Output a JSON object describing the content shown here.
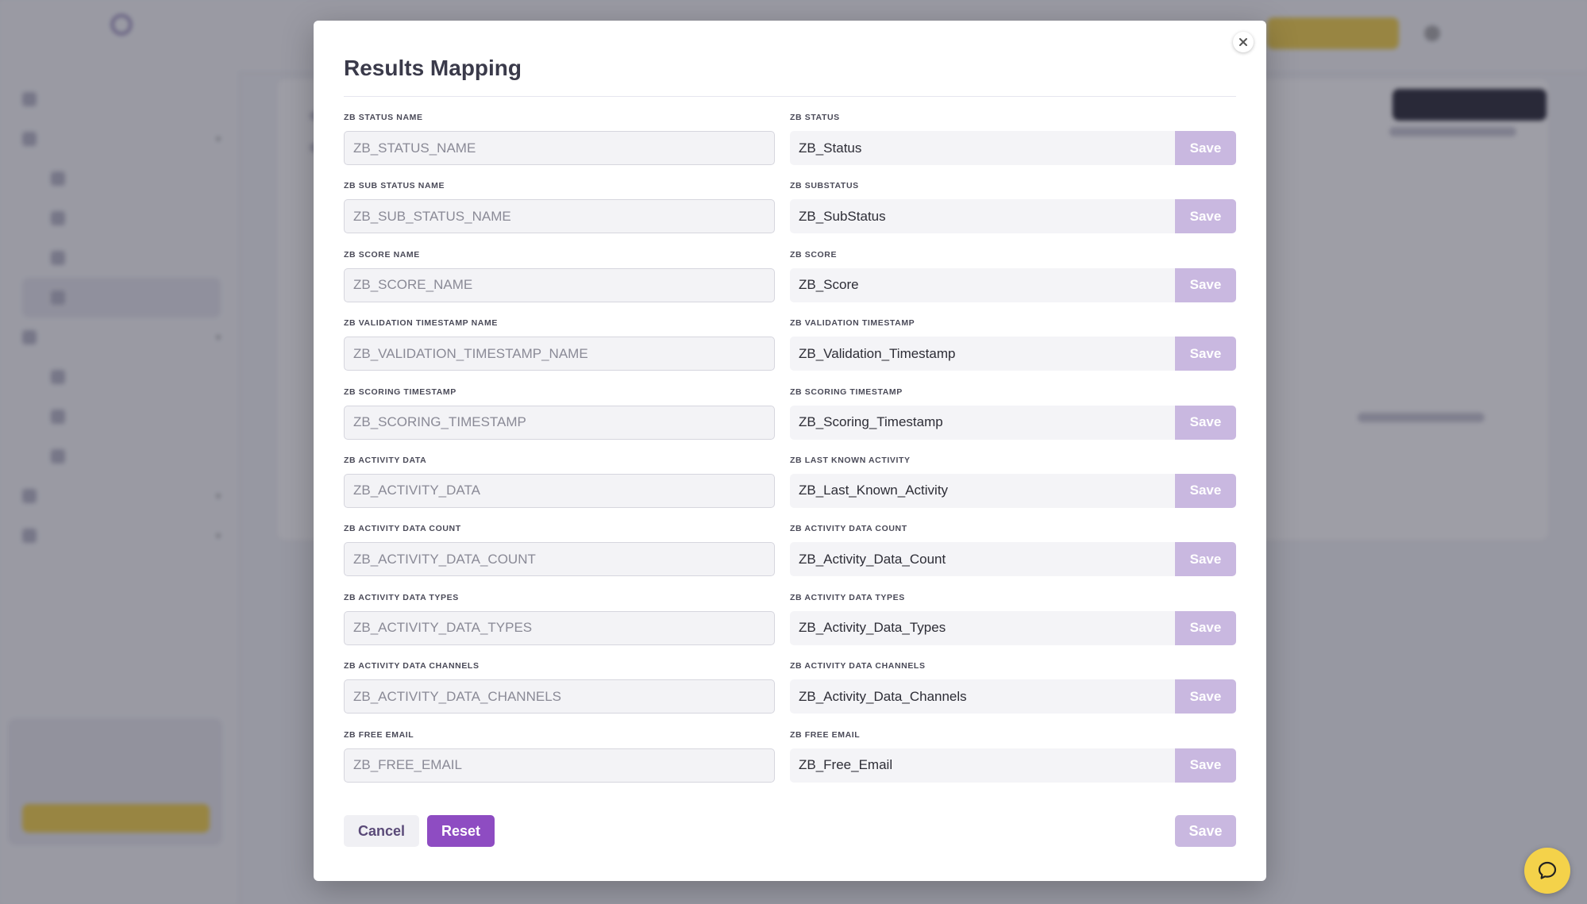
{
  "modal": {
    "title": "Results Mapping",
    "rows": [
      {
        "left_label": "ZB STATUS NAME",
        "left_value": "ZB_STATUS_NAME",
        "right_label": "ZB STATUS",
        "right_value": "ZB_Status",
        "save_label": "Save"
      },
      {
        "left_label": "ZB SUB STATUS NAME",
        "left_value": "ZB_SUB_STATUS_NAME",
        "right_label": "ZB SUBSTATUS",
        "right_value": "ZB_SubStatus",
        "save_label": "Save"
      },
      {
        "left_label": "ZB SCORE NAME",
        "left_value": "ZB_SCORE_NAME",
        "right_label": "ZB SCORE",
        "right_value": "ZB_Score",
        "save_label": "Save"
      },
      {
        "left_label": "ZB VALIDATION TIMESTAMP NAME",
        "left_value": "ZB_VALIDATION_TIMESTAMP_NAME",
        "right_label": "ZB VALIDATION TIMESTAMP",
        "right_value": "ZB_Validation_Timestamp",
        "save_label": "Save"
      },
      {
        "left_label": "ZB SCORING TIMESTAMP",
        "left_value": "ZB_SCORING_TIMESTAMP",
        "right_label": "ZB SCORING TIMESTAMP",
        "right_value": "ZB_Scoring_Timestamp",
        "save_label": "Save"
      },
      {
        "left_label": "ZB ACTIVITY DATA",
        "left_value": "ZB_ACTIVITY_DATA",
        "right_label": "ZB LAST KNOWN ACTIVITY",
        "right_value": "ZB_Last_Known_Activity",
        "save_label": "Save"
      },
      {
        "left_label": "ZB ACTIVITY DATA COUNT",
        "left_value": "ZB_ACTIVITY_DATA_COUNT",
        "right_label": "ZB ACTIVITY DATA COUNT",
        "right_value": "ZB_Activity_Data_Count",
        "save_label": "Save"
      },
      {
        "left_label": "ZB ACTIVITY DATA TYPES",
        "left_value": "ZB_ACTIVITY_DATA_TYPES",
        "right_label": "ZB ACTIVITY DATA TYPES",
        "right_value": "ZB_Activity_Data_Types",
        "save_label": "Save"
      },
      {
        "left_label": "ZB ACTIVITY DATA CHANNELS",
        "left_value": "ZB_ACTIVITY_DATA_CHANNELS",
        "right_label": "ZB ACTIVITY DATA CHANNELS",
        "right_value": "ZB_Activity_Data_Channels",
        "save_label": "Save"
      },
      {
        "left_label": "ZB FREE EMAIL",
        "left_value": "ZB_FREE_EMAIL",
        "right_label": "ZB FREE EMAIL",
        "right_value": "ZB_Free_Email",
        "save_label": "Save"
      }
    ],
    "footer": {
      "cancel_label": "Cancel",
      "reset_label": "Reset",
      "save_label": "Save"
    }
  },
  "icons": {
    "close": "close-icon",
    "chat": "chat-bubble-icon"
  },
  "colors": {
    "accent": "#8e4cc2",
    "save_disabled": "#c9b8e0",
    "brand_yellow": "#f4d24a",
    "overlay": "#28283a"
  }
}
